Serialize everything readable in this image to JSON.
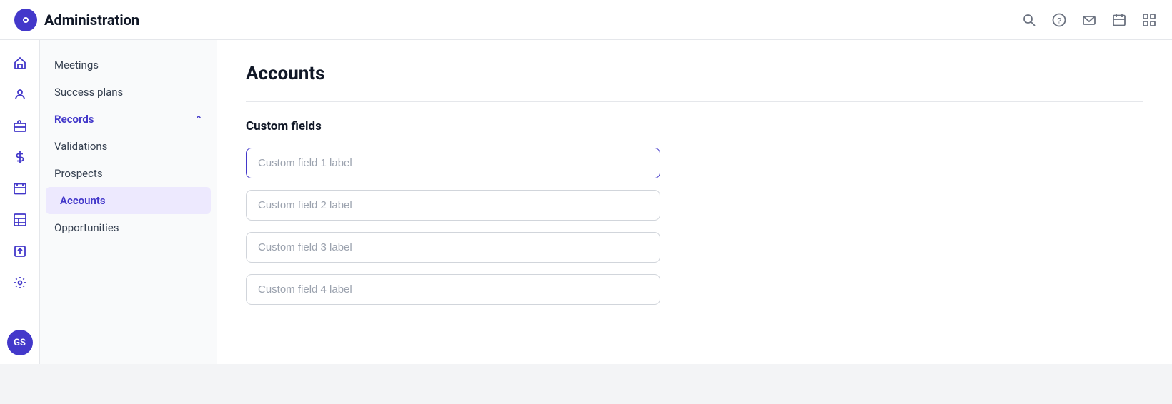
{
  "header": {
    "title": "Administration",
    "logo_text": "O",
    "icons": [
      "search-icon",
      "help-icon",
      "mail-icon",
      "calendar-icon",
      "grid-icon"
    ]
  },
  "icon_sidebar": {
    "items": [
      {
        "name": "home-icon",
        "symbol": "⌂"
      },
      {
        "name": "users-icon",
        "symbol": "👤"
      },
      {
        "name": "briefcase-icon",
        "symbol": "💼"
      },
      {
        "name": "dollar-icon",
        "symbol": "$"
      },
      {
        "name": "calendar-icon",
        "symbol": "📅"
      },
      {
        "name": "table-icon",
        "symbol": "⊞"
      },
      {
        "name": "upload-icon",
        "symbol": "⬆"
      },
      {
        "name": "settings-icon",
        "symbol": "⚙"
      }
    ],
    "avatar": {
      "initials": "GS"
    }
  },
  "nav_sidebar": {
    "items": [
      {
        "label": "Meetings",
        "type": "link",
        "name": "meetings"
      },
      {
        "label": "Success plans",
        "type": "link",
        "name": "success-plans"
      },
      {
        "label": "Records",
        "type": "section",
        "name": "records",
        "expanded": true
      },
      {
        "label": "Validations",
        "type": "sub-link",
        "name": "validations"
      },
      {
        "label": "Prospects",
        "type": "sub-link",
        "name": "prospects"
      },
      {
        "label": "Accounts",
        "type": "sub-link",
        "name": "accounts",
        "active": true
      },
      {
        "label": "Opportunities",
        "type": "sub-link",
        "name": "opportunities"
      }
    ]
  },
  "main": {
    "page_title": "Accounts",
    "section_title": "Custom fields",
    "fields": [
      {
        "placeholder": "Custom field 1 label",
        "name": "custom-field-1",
        "focused": true
      },
      {
        "placeholder": "Custom field 2 label",
        "name": "custom-field-2",
        "focused": false
      },
      {
        "placeholder": "Custom field 3 label",
        "name": "custom-field-3",
        "focused": false
      },
      {
        "placeholder": "Custom field 4 label",
        "name": "custom-field-4",
        "focused": false
      }
    ]
  }
}
